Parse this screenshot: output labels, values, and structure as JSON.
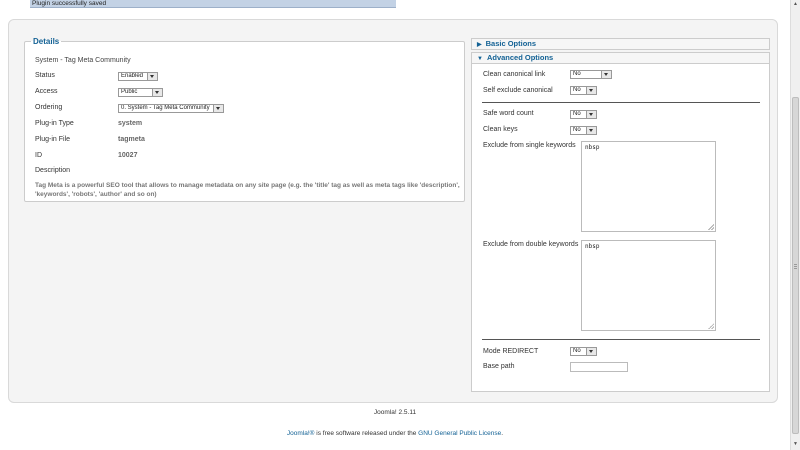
{
  "message": "Plugin successfully saved",
  "details": {
    "legend": "Details",
    "plugin_name": "System - Tag Meta Community",
    "status_label": "Status",
    "status_value": "Enabled",
    "access_label": "Access",
    "access_value": "Public",
    "ordering_label": "Ordering",
    "ordering_value": "0. System - Tag Meta Community",
    "type_label": "Plug-in Type",
    "type_value": "system",
    "file_label": "Plug-in File",
    "file_value": "tagmeta",
    "id_label": "ID",
    "id_value": "10027",
    "description_label": "Description",
    "description_text": "Tag Meta is a powerful SEO tool that allows to manage metadata on any site page (e.g. the 'title' tag as well as meta tags like 'description', 'keywords', 'robots', 'author' and so on)"
  },
  "options": {
    "basic_label": "Basic Options",
    "advanced_label": "Advanced Options",
    "clean_canonical_label": "Clean canonical link",
    "clean_canonical_value": "No",
    "self_exclude_label": "Self exclude canonical",
    "self_exclude_value": "No",
    "safe_word_count_label": "Safe word count",
    "safe_word_count_value": "No",
    "clean_keys_label": "Clean keys",
    "clean_keys_value": "No",
    "exclude_single_label": "Exclude from single keywords",
    "exclude_single_value": "nbsp",
    "exclude_double_label": "Exclude from double keywords",
    "exclude_double_value": "nbsp",
    "mode_redirect_label": "Mode REDIRECT",
    "mode_redirect_value": "No",
    "base_path_label": "Base path",
    "base_path_value": ""
  },
  "footer": {
    "version": "Joomla! 2.5.11",
    "license_link1": "Joomla!®",
    "license_middle": " is free software released under the ",
    "license_link2": "GNU General Public License",
    "license_end": "."
  }
}
